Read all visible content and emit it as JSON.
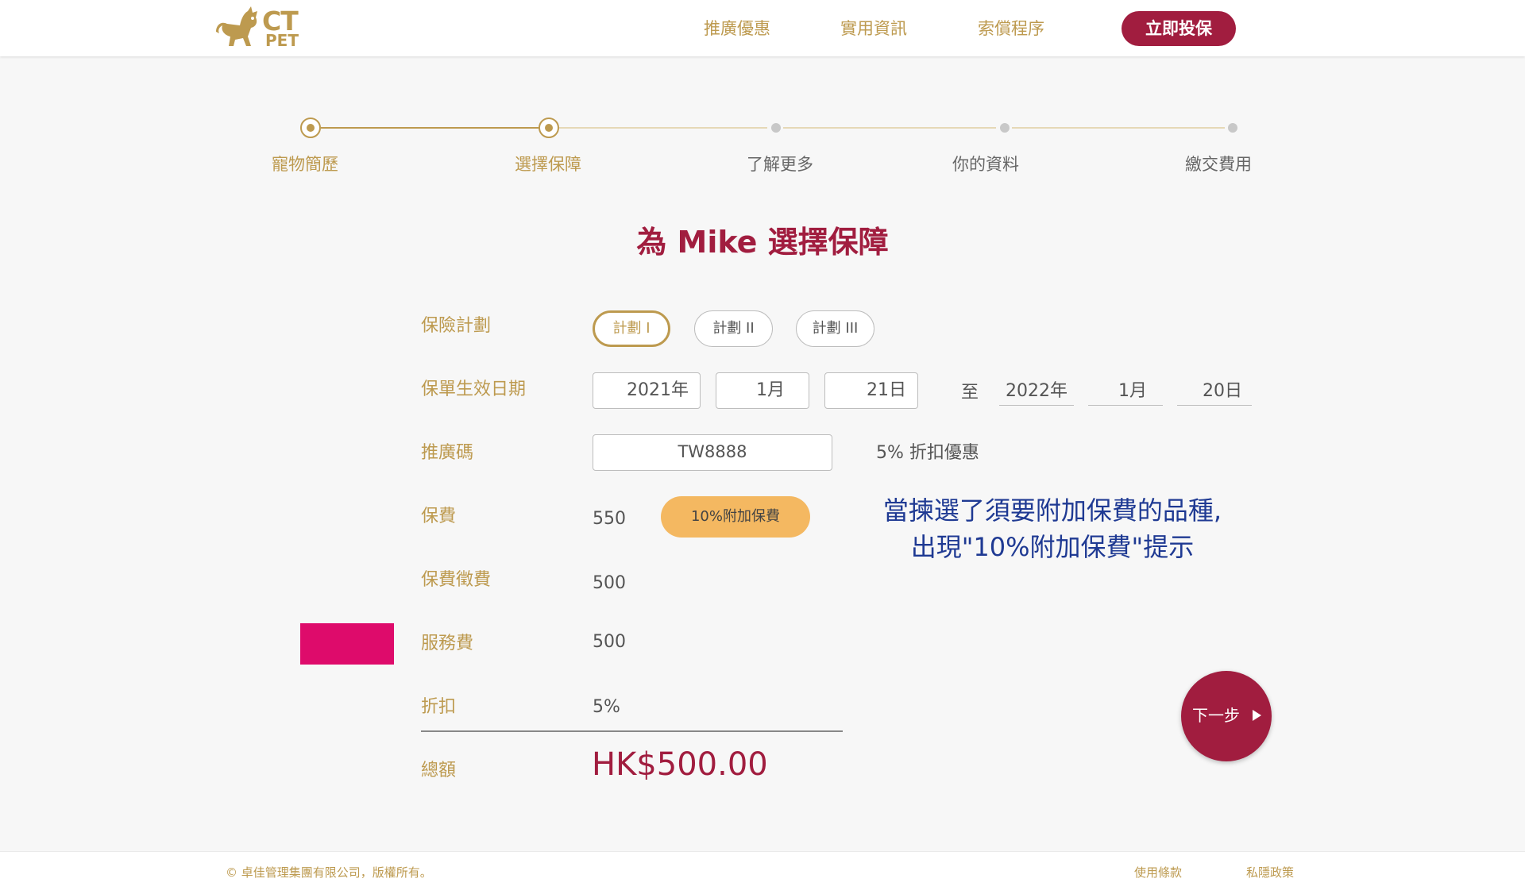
{
  "header": {
    "logo_text_top": "CT",
    "logo_text_bottom": "PET",
    "nav": [
      "推廣優惠",
      "實用資訊",
      "索償程序"
    ],
    "cta_label": "立即投保"
  },
  "stepper": {
    "steps": [
      "寵物簡歷",
      "選擇保障",
      "了解更多",
      "你的資料",
      "繳交費用"
    ]
  },
  "title": "為 Mike 選擇保障",
  "form": {
    "plan_label": "保險計劃",
    "plans": [
      "計劃 I",
      "計劃 II",
      "計劃 III"
    ],
    "date_label": "保單生效日期",
    "start_year": "2021年",
    "start_month": "1月",
    "start_day": "21日",
    "to_label": "至",
    "end_year": "2022年",
    "end_month": "1月",
    "end_day": "20日",
    "promo_label": "推廣碼",
    "promo_code": "TW8888",
    "promo_discount": "5% 折扣優惠",
    "premium_label": "保費",
    "premium_value": "550",
    "surcharge_badge": "10%附加保費",
    "levy_label": "保費徵費",
    "levy_value": "500",
    "service_label": "服務費",
    "service_value": "500",
    "discount_label": "折扣",
    "discount_value": "5%",
    "total_label": "總額",
    "total_value": "HK$500.00"
  },
  "annotation": {
    "line1": "當揀選了須要附加保費的品種,",
    "line2": "出現\"10%附加保費\"提示"
  },
  "next_label": "下一步",
  "footer": {
    "copyright": "© 卓佳管理集團有限公司，版權所有。",
    "terms": "使用條款",
    "privacy": "私隱政策"
  },
  "colors": {
    "gold": "#bd9a4f",
    "brand_red": "#a11d3f",
    "badge_orange": "#f4b861",
    "annotation_blue": "#1f3a93",
    "marker_pink": "#de0b6b"
  }
}
